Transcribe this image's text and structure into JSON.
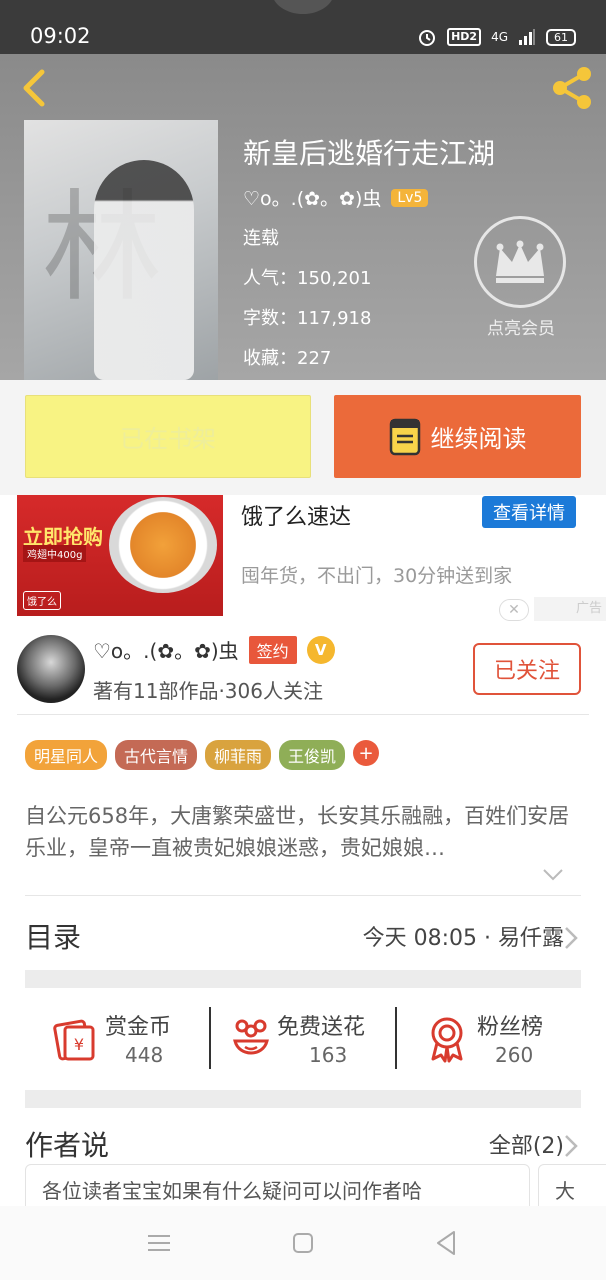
{
  "status_bar": {
    "time": "09:02",
    "network": "4G",
    "battery": "61",
    "hd": "HD2"
  },
  "book": {
    "title": "新皇后逃婚行走江湖",
    "author": "♡o。.(✿。✿)虫",
    "level": "Lv5",
    "status": "连载",
    "popularity": "人气：150,201",
    "word_count": "字数：117,918",
    "collections": "收藏：227",
    "cover_char": "林"
  },
  "vip": {
    "label": "点亮会员"
  },
  "actions": {
    "shelf_label": "已在书架",
    "read_label": "继续阅读"
  },
  "ad": {
    "title": "饿了么速达",
    "detail_button": "查看详情",
    "description": "囤年货，不出门，30分钟送到家",
    "tag": "广告",
    "close": "✕",
    "image_title": "立即抢购",
    "image_sub": "鸡翅中400g",
    "image_logo": "饿了么"
  },
  "author_card": {
    "name": "♡o。.(✿。✿)虫",
    "sign_badge": "签约",
    "v_badge": "V",
    "stats": "著有11部作品·306人关注",
    "follow_label": "已关注"
  },
  "tags": [
    {
      "label": "明星同人",
      "color": "#f2a33a"
    },
    {
      "label": "古代言情",
      "color": "#c46a55"
    },
    {
      "label": "柳菲雨",
      "color": "#d9a33e"
    },
    {
      "label": "王俊凯",
      "color": "#8fae57"
    }
  ],
  "tag_add": "+",
  "synopsis": "自公元658年，大唐繁荣盛世，长安其乐融融，百姓们安居乐业，皇帝一直被贵妃娘娘迷惑，贵妃娘娘…",
  "catalog": {
    "title": "目录",
    "latest": "今天 08:05 · 易仟露"
  },
  "stats": [
    {
      "label": "赏金币",
      "value": "448"
    },
    {
      "label": "免费送花",
      "value": "163"
    },
    {
      "label": "粉丝榜",
      "value": "260"
    }
  ],
  "author_says": {
    "title": "作者说",
    "all_label": "全部(2)",
    "messages": [
      "各位读者宝宝如果有什么疑问可以问作者哈",
      "大"
    ]
  },
  "colors": {
    "accent": "#eb6a3a",
    "shelf": "#f8f383",
    "link_blue": "#1c7ad8",
    "gold": "#f4b43a"
  }
}
